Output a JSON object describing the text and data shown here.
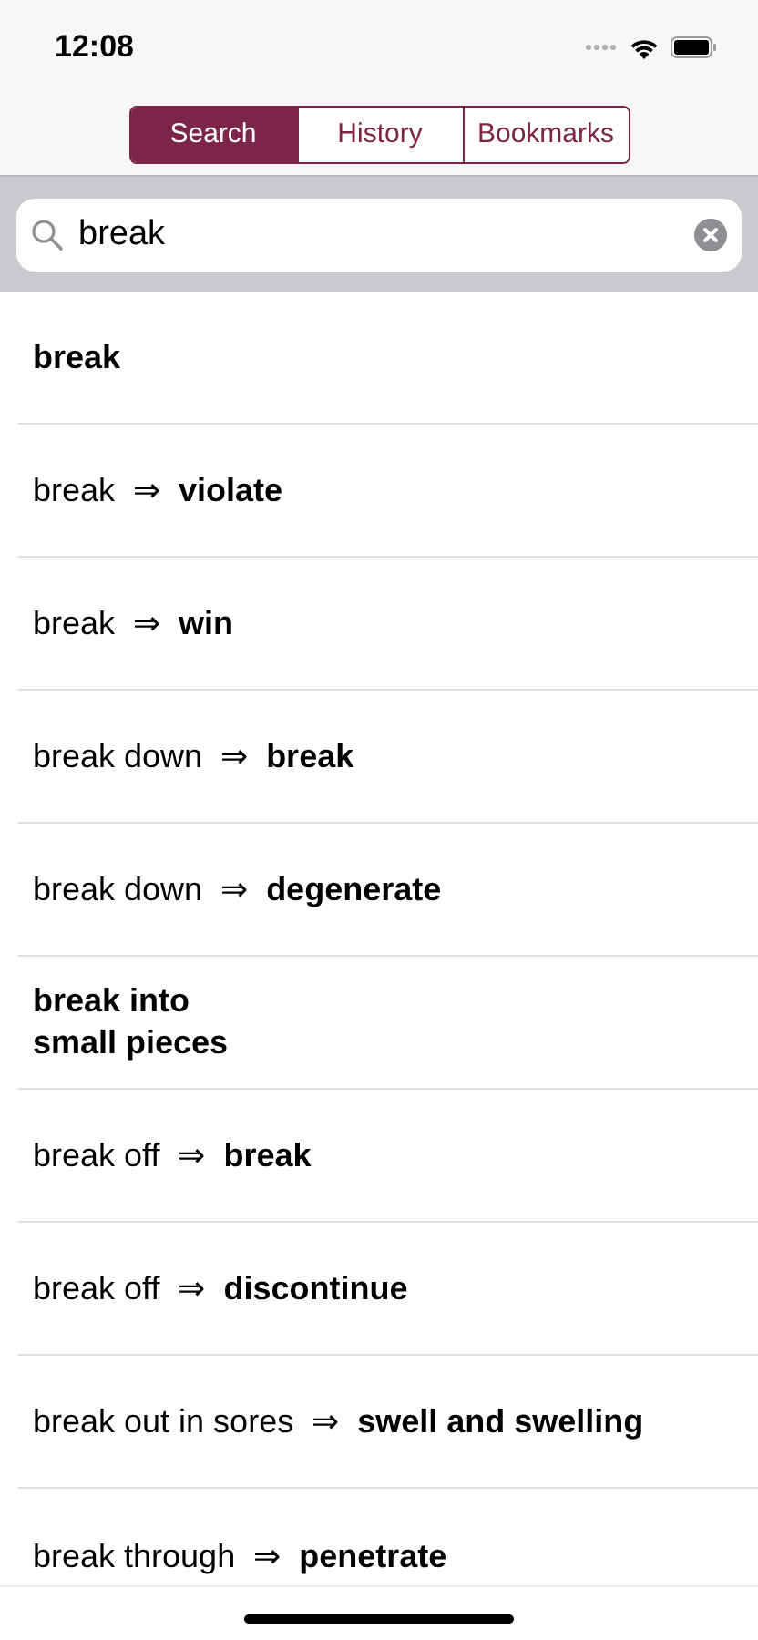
{
  "status_bar": {
    "time": "12:08"
  },
  "tabs": [
    {
      "label": "Search",
      "selected": true
    },
    {
      "label": "History",
      "selected": false
    },
    {
      "label": "Bookmarks",
      "selected": false
    }
  ],
  "search": {
    "value": "break"
  },
  "results": [
    {
      "kind": "headword",
      "text": "break"
    },
    {
      "kind": "crossref",
      "text": "break  ⇒  **violate**"
    },
    {
      "kind": "crossref",
      "text": "break  ⇒  **win**"
    },
    {
      "kind": "crossref",
      "text": "break down  ⇒  **break**"
    },
    {
      "kind": "crossref",
      "text": "break down  ⇒  **degenerate**"
    },
    {
      "kind": "headword",
      "text": "break into\nsmall pieces"
    },
    {
      "kind": "crossref",
      "text": "break off  ⇒  **break**"
    },
    {
      "kind": "crossref",
      "text": "break off  ⇒  **discontinue**"
    },
    {
      "kind": "crossref",
      "text": "break out in sores  ⇒  **swell and swelling**"
    },
    {
      "kind": "crossref",
      "text": "break through  ⇒  **penetrate**"
    }
  ]
}
